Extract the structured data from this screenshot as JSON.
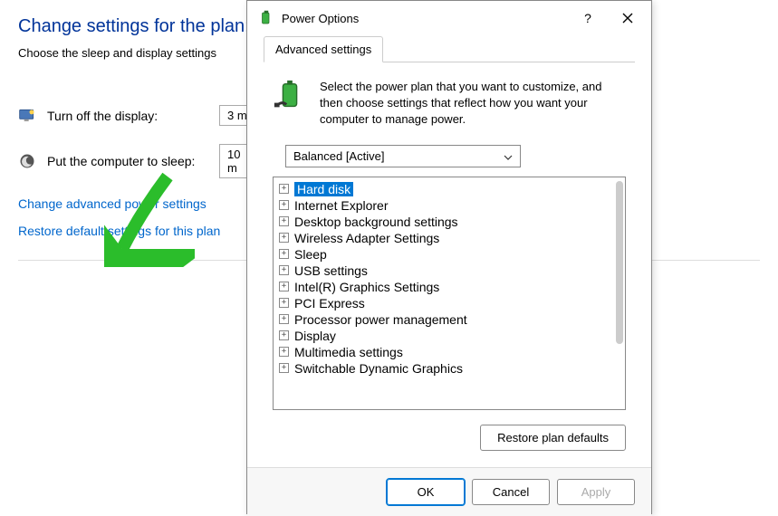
{
  "background": {
    "title": "Change settings for the plan:",
    "subtitle": "Choose the sleep and display settings",
    "rows": [
      {
        "label": "Turn off the display:",
        "value": "3 m"
      },
      {
        "label": "Put the computer to sleep:",
        "value": "10 m"
      }
    ],
    "link_advanced": "Change advanced power settings",
    "link_restore": "Restore default settings for this plan"
  },
  "dialog": {
    "title": "Power Options",
    "tab": "Advanced settings",
    "instruction": "Select the power plan that you want to customize, and then choose settings that reflect how you want your computer to manage power.",
    "plan_selected": "Balanced [Active]",
    "tree": [
      {
        "label": "Hard disk",
        "selected": true
      },
      {
        "label": "Internet Explorer"
      },
      {
        "label": "Desktop background settings"
      },
      {
        "label": "Wireless Adapter Settings"
      },
      {
        "label": "Sleep"
      },
      {
        "label": "USB settings"
      },
      {
        "label": "Intel(R) Graphics Settings"
      },
      {
        "label": "PCI Express"
      },
      {
        "label": "Processor power management"
      },
      {
        "label": "Display"
      },
      {
        "label": "Multimedia settings"
      },
      {
        "label": "Switchable Dynamic Graphics"
      }
    ],
    "restore_button": "Restore plan defaults",
    "ok": "OK",
    "cancel": "Cancel",
    "apply": "Apply"
  }
}
